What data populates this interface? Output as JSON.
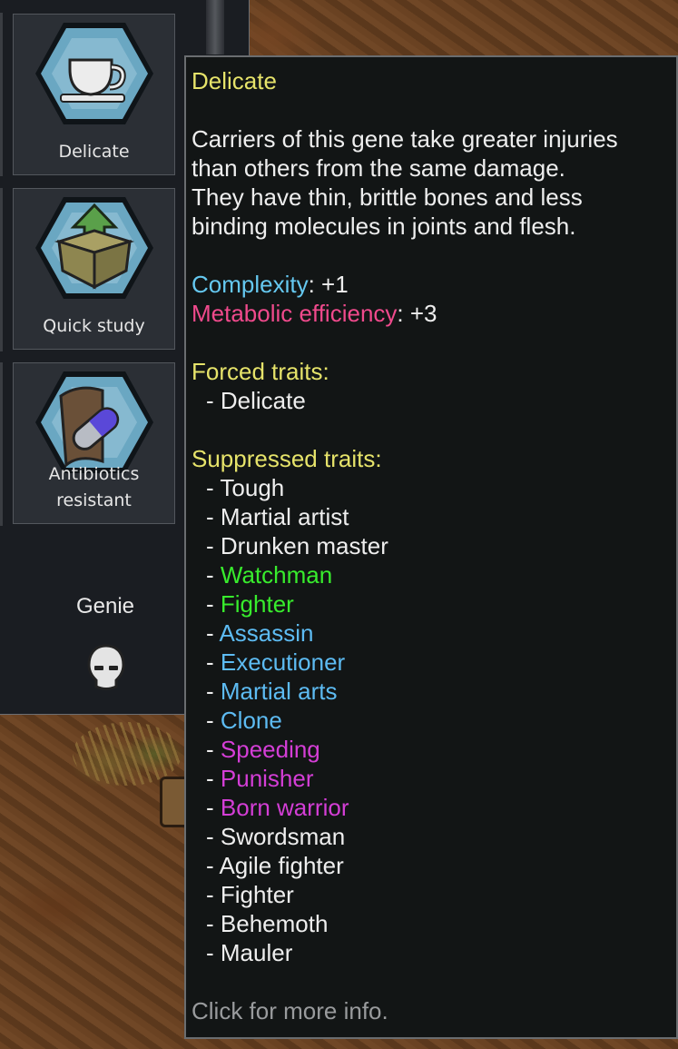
{
  "genes": [
    {
      "label": "Delicate",
      "icon": "teacup-icon"
    },
    {
      "label": "Quick study",
      "icon": "box-arrow-icon"
    },
    {
      "label": "Antibiotics\nresistant",
      "icon": "pill-icon"
    }
  ],
  "xenotype": {
    "name": "Genie",
    "icon": "skull-icon"
  },
  "tooltip": {
    "title": "Delicate",
    "description": [
      "Carriers of this gene take greater injuries",
      "than others from the same damage.",
      "They have thin, brittle bones and less",
      "binding molecules in joints and flesh."
    ],
    "complexity_label": "Complexity",
    "complexity_value": ": +1",
    "metabolic_label": "Metabolic efficiency",
    "metabolic_value": ": +3",
    "forced_header": "Forced traits:",
    "forced_traits": [
      "- Delicate"
    ],
    "suppressed_header": "Suppressed traits:",
    "suppressed_traits": [
      {
        "text": "- ",
        "name": "Tough",
        "color": "white"
      },
      {
        "text": "- ",
        "name": "Martial artist",
        "color": "white"
      },
      {
        "text": "- ",
        "name": "Drunken master",
        "color": "white"
      },
      {
        "text": "- ",
        "name": "Watchman",
        "color": "green"
      },
      {
        "text": "- ",
        "name": "Fighter",
        "color": "green"
      },
      {
        "text": "- ",
        "name": "Assassin",
        "color": "blue"
      },
      {
        "text": "- ",
        "name": "Executioner",
        "color": "blue"
      },
      {
        "text": "- ",
        "name": "Martial arts",
        "color": "blue"
      },
      {
        "text": "- ",
        "name": "Clone",
        "color": "blue"
      },
      {
        "text": "- ",
        "name": "Speeding",
        "color": "magenta"
      },
      {
        "text": "- ",
        "name": "Punisher",
        "color": "magenta"
      },
      {
        "text": "- ",
        "name": "Born warrior",
        "color": "magenta"
      },
      {
        "text": "- ",
        "name": "Swordsman",
        "color": "white"
      },
      {
        "text": "- ",
        "name": "Agile fighter",
        "color": "white"
      },
      {
        "text": "- ",
        "name": "Fighter",
        "color": "white"
      },
      {
        "text": "- ",
        "name": "Behemoth",
        "color": "white"
      },
      {
        "text": "- ",
        "name": "Mauler",
        "color": "white"
      }
    ],
    "footer": "Click for more info."
  },
  "colors": {
    "title": "#e6e36a",
    "complexity": "#65c8f0",
    "metabolic": "#f04a8c",
    "green": "#38ec2d",
    "blue": "#5dbbf2",
    "magenta": "#d43ed6"
  }
}
